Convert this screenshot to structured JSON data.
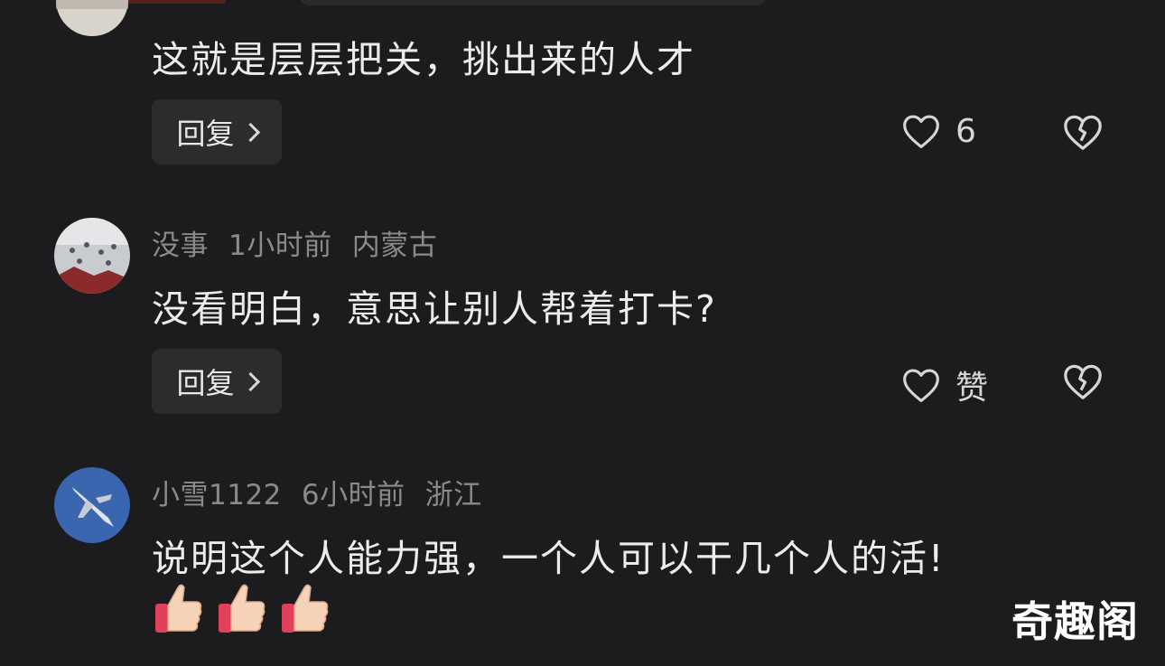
{
  "comments": [
    {
      "text": "这就是层层把关，挑出来的人才",
      "reply_label": "回复",
      "like_count": "6"
    },
    {
      "username": "没事",
      "time": "1小时前",
      "location": "内蒙古",
      "text": "没看明白，意思让别人帮着打卡?",
      "reply_label": "回复",
      "like_count": "赞"
    },
    {
      "username": "小雪1122",
      "time": "6小时前",
      "location": "浙江",
      "text": "说明这个人能力强，一个人可以干几个人的活!",
      "emoji_count": 3
    }
  ],
  "watermark": "奇趣阁",
  "icons": {
    "like": "heart-outline-icon",
    "dislike": "broken-heart-icon",
    "reply": "chevron-right-icon",
    "emoji": "thumbs-up-emoji"
  },
  "colors": {
    "background": "#1c1c1e",
    "button_bg": "#2c2c2e",
    "meta_text": "#8a8a8c",
    "main_text": "#ececec",
    "watermark": "#ffffff"
  }
}
